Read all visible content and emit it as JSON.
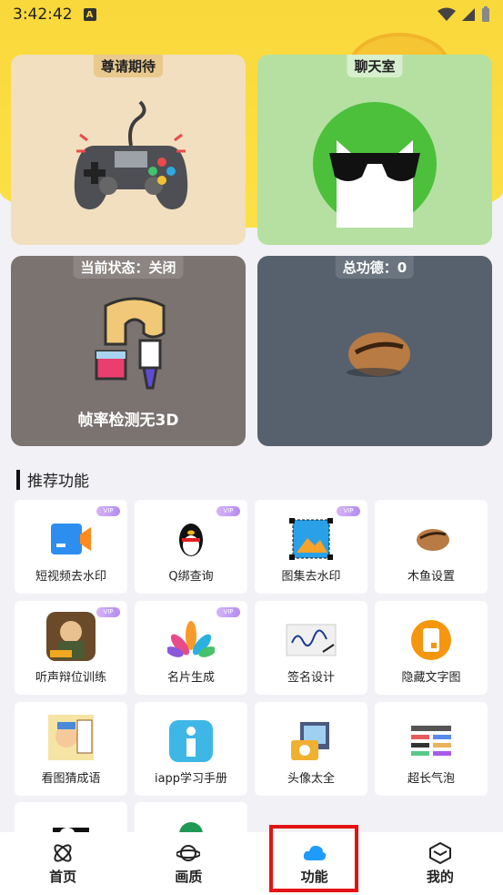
{
  "status_bar": {
    "time": "3:42:42",
    "a_badge": "A"
  },
  "cards": {
    "game": {
      "tag": "尊请期待"
    },
    "chat": {
      "tag": "聊天室"
    },
    "fps": {
      "tag": "当前状态：关闭",
      "label": "帧率检测无3D"
    },
    "merit": {
      "tag": "总功德：0"
    }
  },
  "section": {
    "title": "推荐功能"
  },
  "vip_badge": "VIP",
  "grid": [
    {
      "label": "短视频去水印",
      "icon": "video-camera-icon",
      "vip": true
    },
    {
      "label": "Q绑查询",
      "icon": "penguin-icon",
      "vip": true
    },
    {
      "label": "图集去水印",
      "icon": "image-select-icon",
      "vip": true
    },
    {
      "label": "木鱼设置",
      "icon": "wooden-fish-icon",
      "vip": false
    },
    {
      "label": "听声辩位训练",
      "icon": "game-character-icon",
      "vip": true
    },
    {
      "label": "名片生成",
      "icon": "flower-petals-icon",
      "vip": true
    },
    {
      "label": "签名设计",
      "icon": "signature-icon",
      "vip": false
    },
    {
      "label": "隐藏文字图",
      "icon": "phone-note-icon",
      "vip": false
    },
    {
      "label": "看图猜成语",
      "icon": "idiom-character-icon",
      "vip": false
    },
    {
      "label": "iapp学习手册",
      "icon": "info-i-icon",
      "vip": false
    },
    {
      "label": "头像太全",
      "icon": "photo-camera-icon",
      "vip": false
    },
    {
      "label": "超长气泡",
      "icon": "bubble-list-icon",
      "vip": false
    }
  ],
  "nav": [
    {
      "label": "首页",
      "icon": "atom-icon"
    },
    {
      "label": "画质",
      "icon": "planet-icon"
    },
    {
      "label": "功能",
      "icon": "cloud-icon",
      "active": true
    },
    {
      "label": "我的",
      "icon": "cube-icon"
    }
  ],
  "colors": {
    "header_yellow": "#f9d83b",
    "highlight_red": "#e21414",
    "nav_active_blue": "#1e9bff"
  }
}
